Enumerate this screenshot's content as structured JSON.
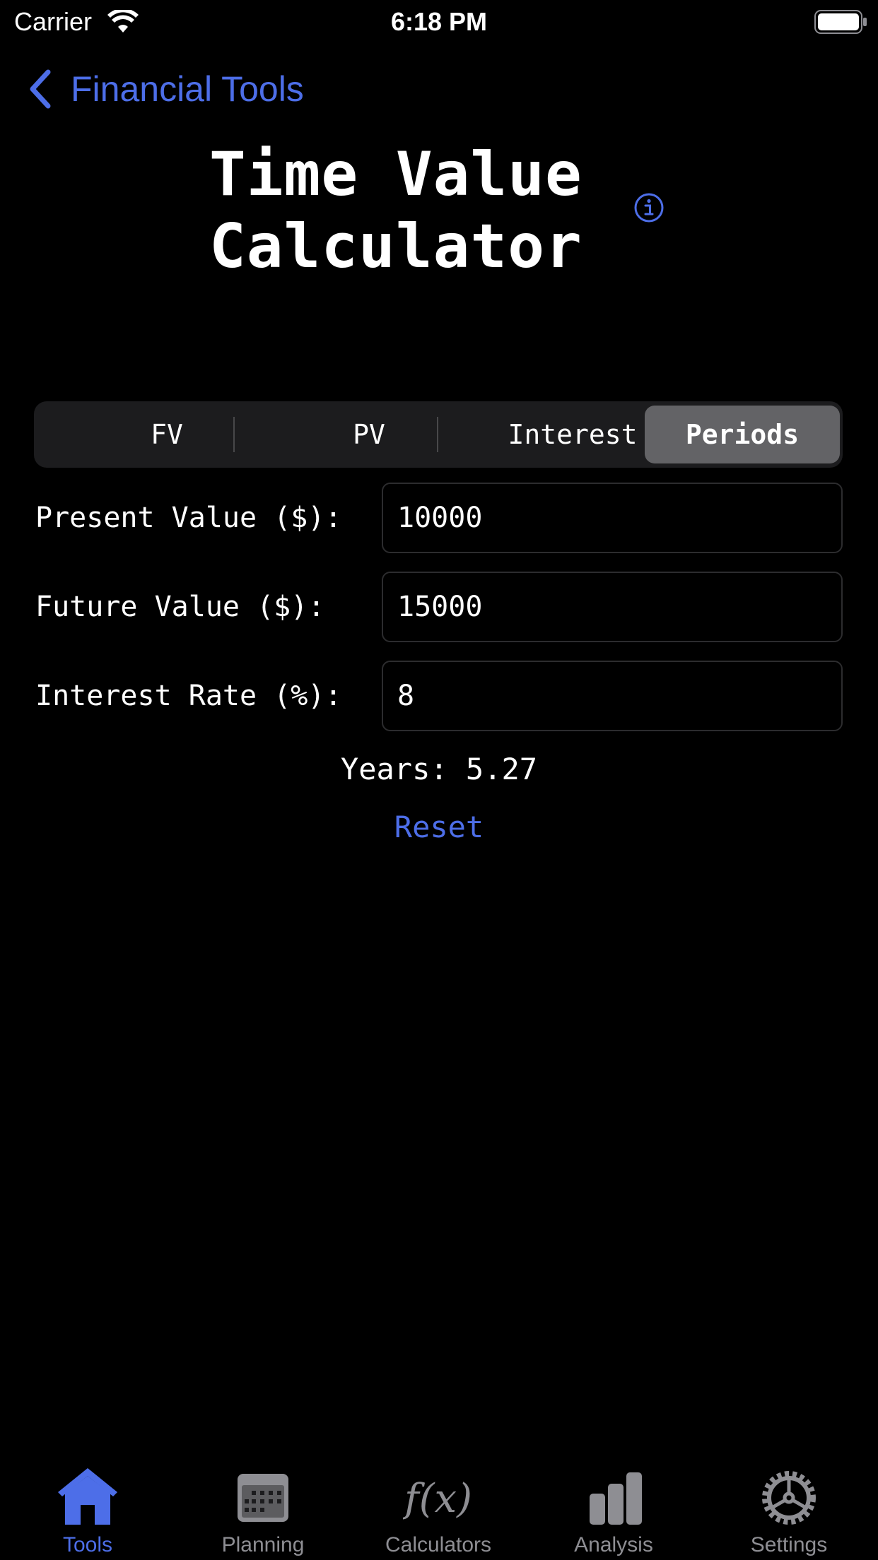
{
  "status_bar": {
    "carrier": "Carrier",
    "time": "6:18 PM",
    "wifi_icon": "wifi-icon",
    "battery_icon": "battery-icon"
  },
  "nav": {
    "back_label": "Financial Tools",
    "back_icon": "chevron-left-icon"
  },
  "page": {
    "title_line1": "Time Value",
    "title_line2": "Calculator",
    "info_icon": "info-icon"
  },
  "segments": {
    "items": [
      {
        "label": "FV",
        "selected": false
      },
      {
        "label": "PV",
        "selected": false
      },
      {
        "label": "Interest",
        "selected": false
      },
      {
        "label": "Periods",
        "selected": true
      }
    ]
  },
  "form": {
    "fields": [
      {
        "label": "Present Value ($):",
        "value": "10000"
      },
      {
        "label": "Future Value ($):",
        "value": "15000"
      },
      {
        "label": "Interest Rate (%):",
        "value": "8"
      }
    ],
    "result": "Years: 5.27",
    "reset_label": "Reset"
  },
  "tab_bar": {
    "items": [
      {
        "label": "Tools",
        "icon": "house-icon",
        "active": true
      },
      {
        "label": "Planning",
        "icon": "calendar-icon",
        "active": false
      },
      {
        "label": "Calculators",
        "icon": "function-icon",
        "active": false
      },
      {
        "label": "Analysis",
        "icon": "bar-chart-icon",
        "active": false
      },
      {
        "label": "Settings",
        "icon": "gear-icon",
        "active": false
      }
    ]
  },
  "colors": {
    "accent": "#4d6ee8",
    "background": "#000000",
    "segment_bg": "#1c1c1e",
    "segment_selected": "#636366",
    "inactive_tab": "#8e8e93"
  }
}
